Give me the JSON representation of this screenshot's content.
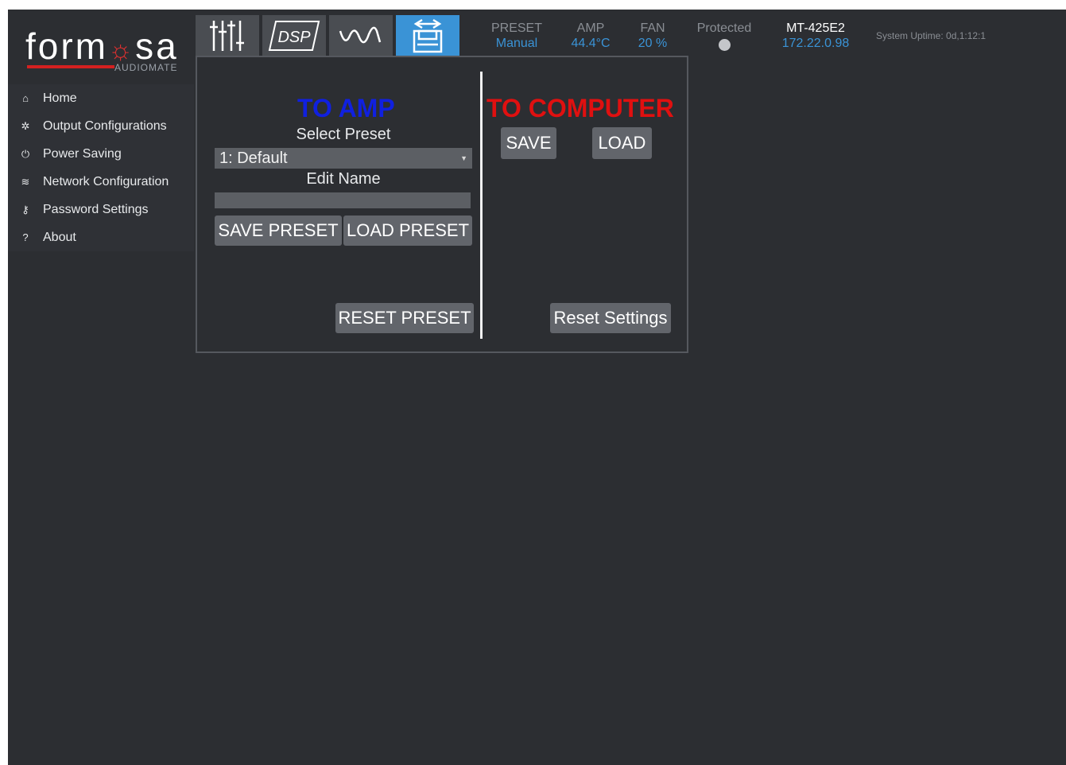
{
  "logo": {
    "brand_prefix": "form",
    "brand_mark": "☼",
    "brand_suffix": "sa",
    "sub": "AUDIOMATE"
  },
  "sidebar": {
    "items": [
      {
        "icon": "home-icon",
        "glyph": "⌂",
        "label": "Home"
      },
      {
        "icon": "gear-icon",
        "glyph": "✲",
        "label": "Output Configurations"
      },
      {
        "icon": "power-icon",
        "glyph": "⏻",
        "label": "Power Saving"
      },
      {
        "icon": "wifi-icon",
        "glyph": "≋",
        "label": "Network Configuration"
      },
      {
        "icon": "key-icon",
        "glyph": "⚷",
        "label": "Password Settings"
      },
      {
        "icon": "question-icon",
        "glyph": "?",
        "label": "About"
      }
    ]
  },
  "toolbar": {
    "tabs": [
      {
        "icon": "sliders-icon",
        "label": ""
      },
      {
        "icon": "dsp-icon",
        "label": "DSP"
      },
      {
        "icon": "waveform-icon",
        "label": ""
      },
      {
        "icon": "transfer-icon",
        "label": "",
        "active": true
      }
    ]
  },
  "status": {
    "preset": {
      "label": "PRESET",
      "value": "Manual"
    },
    "amp": {
      "label": "AMP",
      "value": "44.4°C"
    },
    "fan": {
      "label": "FAN",
      "value": "20 %"
    },
    "protected": {
      "label": "Protected"
    },
    "device": {
      "model": "MT-425E2",
      "ip": "172.22.0.98"
    },
    "uptime": "System Uptime: 0d,1:12:1"
  },
  "to_amp": {
    "heading": "TO AMP",
    "select_label": "Select Preset",
    "selected": "1: Default",
    "edit_label": "Edit Name",
    "name_value": "",
    "save_label": "SAVE PRESET",
    "load_label": "LOAD PRESET",
    "reset_label": "RESET PRESET"
  },
  "to_computer": {
    "heading": "TO COMPUTER",
    "save_label": "SAVE",
    "load_label": "LOAD",
    "reset_label": "Reset Settings"
  },
  "colors": {
    "accent": "#3a93d6",
    "to_amp": "#1020e0",
    "to_computer": "#e01010",
    "background": "#2c2e32"
  }
}
